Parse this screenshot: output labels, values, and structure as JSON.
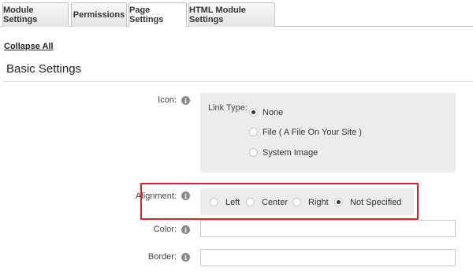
{
  "tabs": [
    {
      "label": "Module Settings",
      "active": false
    },
    {
      "label": "Permissions",
      "active": false
    },
    {
      "label": "Page Settings",
      "active": true
    },
    {
      "label": "HTML Module Settings",
      "active": false
    }
  ],
  "collapse_all": "Collapse All",
  "section_title": "Basic Settings",
  "icon_field": {
    "label": "Icon:",
    "link_type_label": "Link Type:",
    "options": [
      "None",
      "File ( A File On Your Site )",
      "System Image"
    ],
    "selected": "None"
  },
  "alignment_field": {
    "label": "Alignment:",
    "options": [
      "Left",
      "Center",
      "Right",
      "Not Specified"
    ],
    "selected": "Not Specified"
  },
  "color_field": {
    "label": "Color:",
    "value": ""
  },
  "border_field": {
    "label": "Border:",
    "value": ""
  },
  "colors": {
    "highlight": "#e02424",
    "panel": "#ececec"
  }
}
